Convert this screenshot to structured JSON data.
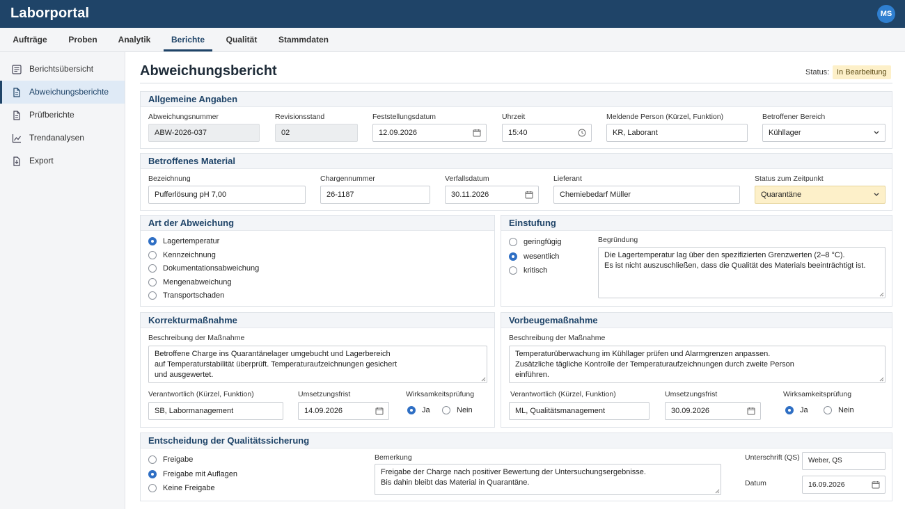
{
  "app": {
    "title": "Laborportal",
    "user_initials": "MS"
  },
  "nav": {
    "tabs": [
      "Aufträge",
      "Proben",
      "Analytik",
      "Berichte",
      "Qualität",
      "Stammdaten"
    ],
    "active": "Berichte"
  },
  "sidebar": {
    "items": [
      "Berichtsübersicht",
      "Abweichungsberichte",
      "Prüfberichte",
      "Trendanalysen",
      "Export"
    ],
    "active": "Abweichungsberichte"
  },
  "page": {
    "title": "Abweichungsbericht",
    "status_label": "Status:",
    "status_value": "In Bearbeitung"
  },
  "allgemein": {
    "heading": "Allgemeine Angaben",
    "nummer_label": "Abweichungsnummer",
    "nummer": "ABW-2026-037",
    "rev_label": "Revisionsstand",
    "rev": "02",
    "datum_label": "Feststellungsdatum",
    "datum": "12.09.2026",
    "uhrzeit_label": "Uhrzeit",
    "uhrzeit": "15:40",
    "person_label": "Meldende Person (Kürzel, Funktion)",
    "person": "KR, Laborant",
    "bereich_label": "Betroffener Bereich",
    "bereich": "Kühllager"
  },
  "material": {
    "heading": "Betroffenes Material",
    "bez_label": "Bezeichnung",
    "bez": "Pufferlösung pH 7,00",
    "charge_label": "Chargennummer",
    "charge": "26-1187",
    "verfall_label": "Verfallsdatum",
    "verfall": "30.11.2026",
    "lieferant_label": "Lieferant",
    "lieferant": "Chemiebedarf Müller",
    "status_label": "Status zum Zeitpunkt",
    "status": "Quarantäne"
  },
  "art": {
    "heading": "Art der Abweichung",
    "options": [
      "Lagertemperatur",
      "Kennzeichnung",
      "Dokumentationsabweichung",
      "Mengenabweichung",
      "Transportschaden"
    ],
    "selected": "Lagertemperatur"
  },
  "einstufung": {
    "heading": "Einstufung",
    "options": [
      "geringfügig",
      "wesentlich",
      "kritisch"
    ],
    "selected": "wesentlich",
    "begr_label": "Begründung",
    "begr_lines": [
      "Die Lagertemperatur lag über den spezifizierten Grenzwerten (2–8 °C).",
      "Es ist nicht auszuschließen, dass die Qualität des Materials beeinträchtigt ist."
    ]
  },
  "korrektur": {
    "heading": "Korrekturmaßnahme",
    "desc_label": "Beschreibung der Maßnahme",
    "desc_lines": [
      "Betroffene Charge ins Quarantänelager umgebucht und Lagerbereich",
      "auf Temperaturstabilität überprüft. Temperaturaufzeichnungen gesichert",
      "und ausgewertet."
    ],
    "verantw_label": "Verantwortlich (Kürzel, Funktion)",
    "verantw": "SB, Labormanagement",
    "frist_label": "Umsetzungsfrist",
    "frist": "14.09.2026",
    "wirk_label": "Wirksamkeitsprüfung",
    "ja": "Ja",
    "nein": "Nein",
    "wirk_selected": "Ja"
  },
  "vorbeugung": {
    "heading": "Vorbeugemaßnahme",
    "desc_label": "Beschreibung der Maßnahme",
    "desc_lines": [
      "Temperaturüberwachung im Kühllager prüfen und Alarmgrenzen anpassen.",
      "Zusätzliche tägliche Kontrolle der Temperaturaufzeichnungen durch zweite Person",
      "einführen."
    ],
    "verantw_label": "Verantwortlich (Kürzel, Funktion)",
    "verantw": "ML, Qualitätsmanagement",
    "frist_label": "Umsetzungsfrist",
    "frist": "30.09.2026",
    "wirk_label": "Wirksamkeitsprüfung",
    "ja": "Ja",
    "nein": "Nein",
    "wirk_selected": "Ja"
  },
  "entscheidung": {
    "heading": "Entscheidung der Qualitätssicherung",
    "options": [
      "Freigabe",
      "Freigabe mit Auflagen",
      "Keine Freigabe"
    ],
    "selected": "Freigabe mit Auflagen",
    "bem_label": "Bemerkung",
    "bem_lines": [
      "Freigabe der Charge nach positiver Bewertung der Untersuchungsergebnisse.",
      "Bis dahin bleibt das Material in Quarantäne."
    ],
    "unterschrift_label": "Unterschrift (QS)",
    "unterschrift": "Weber, QS",
    "datum_label": "Datum",
    "datum": "16.09.2026"
  },
  "icons": {
    "date": "calendar-icon",
    "time": "clock-icon",
    "select": "chevron-down-icon",
    "resize": "resize-grip-icon"
  },
  "colors": {
    "brand": "#1f4468",
    "accent": "#2f6fc4",
    "status_bg": "#fdf0c9"
  }
}
